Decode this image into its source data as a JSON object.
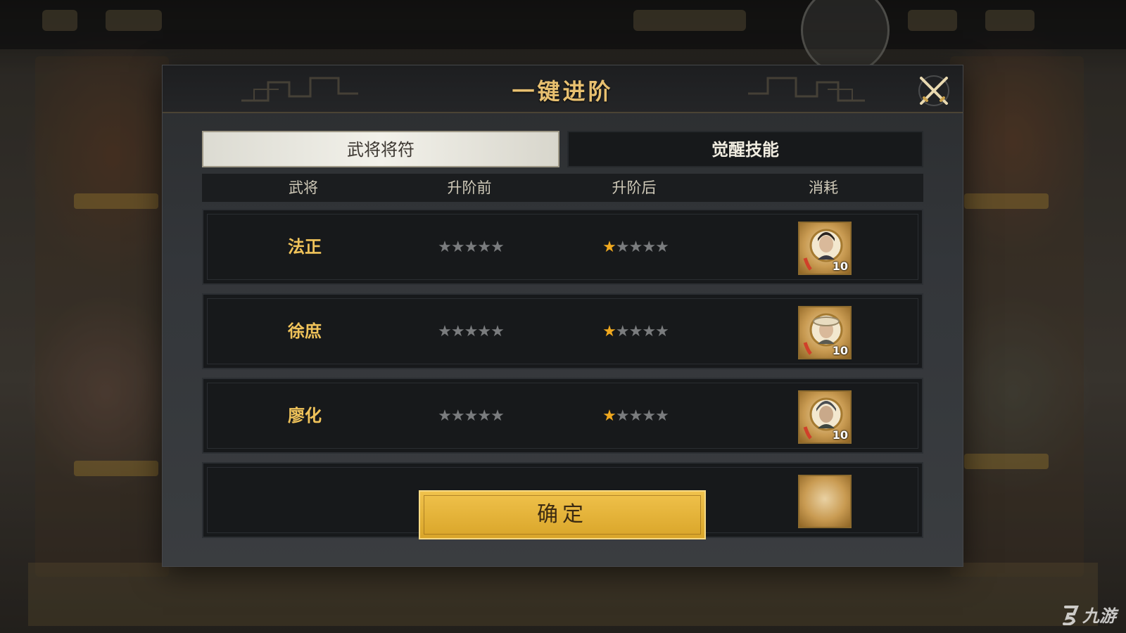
{
  "dialog": {
    "title": "一键进阶",
    "close_icon": "crossed-swords-close-icon"
  },
  "tabs": [
    {
      "label": "武将将符",
      "active": true
    },
    {
      "label": "觉醒技能",
      "active": false
    }
  ],
  "table": {
    "headers": [
      "武将",
      "升阶前",
      "升阶后",
      "消耗"
    ],
    "rows": [
      {
        "name": "法正",
        "before_stars_lit": 0,
        "after_stars_lit": 1,
        "total_stars": 5,
        "cost_icon": "fazheng-token-icon",
        "cost_count": "10"
      },
      {
        "name": "徐庶",
        "before_stars_lit": 0,
        "after_stars_lit": 1,
        "total_stars": 5,
        "cost_icon": "xushu-token-icon",
        "cost_count": "10"
      },
      {
        "name": "廖化",
        "before_stars_lit": 0,
        "after_stars_lit": 1,
        "total_stars": 5,
        "cost_icon": "liaohua-token-icon",
        "cost_count": "10"
      }
    ]
  },
  "confirm_label": "确定",
  "watermark": "九游",
  "colors": {
    "title_gold": "#e8c070",
    "name_gold": "#f0c35a",
    "star_lit": "#f0a91f",
    "star_dim": "#7a7c7e",
    "button_gold": "#e0b03a"
  }
}
